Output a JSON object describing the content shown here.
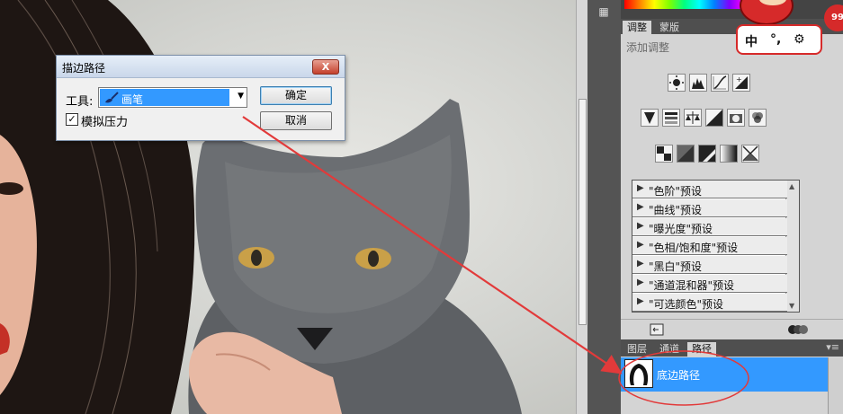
{
  "dialog": {
    "title": "描边路径",
    "close_label": "X",
    "tool_label": "工具:",
    "tool_value": "画笔",
    "simulate_pressure_label": "模拟压力",
    "simulate_pressure_checked": true,
    "ok_label": "确定",
    "cancel_label": "取消"
  },
  "adjustments_panel": {
    "tabs": [
      "调整",
      "蒙版"
    ],
    "active_tab": "调整",
    "heading": "添加调整",
    "icon_rows": [
      [
        "brightness-contrast-icon",
        "levels-icon",
        "curves-icon",
        "exposure-icon"
      ],
      [
        "vibrance-icon",
        "hue-saturation-icon",
        "color-balance-icon",
        "black-white-icon",
        "photo-filter-icon",
        "channel-mixer-icon"
      ],
      [
        "invert-icon",
        "posterize-icon",
        "threshold-icon",
        "gradient-map-icon",
        "selective-color-icon"
      ]
    ],
    "presets": [
      "\"色阶\"预设",
      "\"曲线\"预设",
      "\"曝光度\"预设",
      "\"色相/饱和度\"预设",
      "\"黑白\"预设",
      "\"通道混和器\"预设",
      "\"可选颜色\"预设"
    ]
  },
  "layers_panel": {
    "tabs": [
      "图层",
      "通道",
      "路径"
    ],
    "active_tab": "路径",
    "paths": [
      {
        "name": "底边路径",
        "selected": true
      }
    ]
  },
  "ime": {
    "mode": "中",
    "punct": "°,",
    "settings_icon": "gear-icon",
    "badge": "99"
  },
  "colors": {
    "selection_blue": "#3399ff",
    "annotation_red": "#e23a3a",
    "panel_gray": "#d4d4d4"
  }
}
